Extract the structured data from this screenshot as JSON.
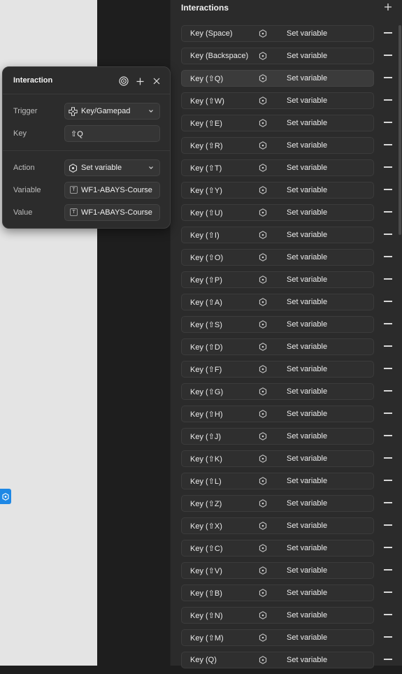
{
  "panel": {
    "title": "Interactions",
    "rows": [
      {
        "trigger": "Key (Space)",
        "action": "Set variable"
      },
      {
        "trigger": "Key (Backspace)",
        "action": "Set variable"
      },
      {
        "trigger": "Key (⇧Q)",
        "action": "Set variable",
        "selected": true
      },
      {
        "trigger": "Key (⇧W)",
        "action": "Set variable"
      },
      {
        "trigger": "Key (⇧E)",
        "action": "Set variable"
      },
      {
        "trigger": "Key (⇧R)",
        "action": "Set variable"
      },
      {
        "trigger": "Key (⇧T)",
        "action": "Set variable"
      },
      {
        "trigger": "Key (⇧Y)",
        "action": "Set variable"
      },
      {
        "trigger": "Key (⇧U)",
        "action": "Set variable"
      },
      {
        "trigger": "Key (⇧I)",
        "action": "Set variable"
      },
      {
        "trigger": "Key (⇧O)",
        "action": "Set variable"
      },
      {
        "trigger": "Key (⇧P)",
        "action": "Set variable"
      },
      {
        "trigger": "Key (⇧A)",
        "action": "Set variable"
      },
      {
        "trigger": "Key (⇧S)",
        "action": "Set variable"
      },
      {
        "trigger": "Key (⇧D)",
        "action": "Set variable"
      },
      {
        "trigger": "Key (⇧F)",
        "action": "Set variable"
      },
      {
        "trigger": "Key (⇧G)",
        "action": "Set variable"
      },
      {
        "trigger": "Key (⇧H)",
        "action": "Set variable"
      },
      {
        "trigger": "Key (⇧J)",
        "action": "Set variable"
      },
      {
        "trigger": "Key (⇧K)",
        "action": "Set variable"
      },
      {
        "trigger": "Key (⇧L)",
        "action": "Set variable"
      },
      {
        "trigger": "Key (⇧Z)",
        "action": "Set variable"
      },
      {
        "trigger": "Key (⇧X)",
        "action": "Set variable"
      },
      {
        "trigger": "Key (⇧C)",
        "action": "Set variable"
      },
      {
        "trigger": "Key (⇧V)",
        "action": "Set variable"
      },
      {
        "trigger": "Key (⇧B)",
        "action": "Set variable"
      },
      {
        "trigger": "Key (⇧N)",
        "action": "Set variable"
      },
      {
        "trigger": "Key (⇧M)",
        "action": "Set variable"
      },
      {
        "trigger": "Key (Q)",
        "action": "Set variable"
      }
    ]
  },
  "popover": {
    "title": "Interaction",
    "trigger_label": "Trigger",
    "trigger_value": "Key/Gamepad",
    "key_label": "Key",
    "key_value": "⇧Q",
    "action_label": "Action",
    "action_value": "Set variable",
    "variable_label": "Variable",
    "variable_value": "WF1-ABAYS-Course",
    "value_label": "Value",
    "value_value": "WF1-ABAYS-Course",
    "variable_type_badge": "T",
    "value_type_badge": "T"
  },
  "icons": {
    "panel_add": "plus-icon",
    "row_action": "hexagon-variable-icon",
    "row_remove": "minus-icon",
    "popover_target": "target-icon",
    "popover_add": "plus-icon",
    "popover_close": "close-icon",
    "trigger": "gamepad-icon",
    "action": "hexagon-variable-icon",
    "dropdown": "chevron-down-icon",
    "canvas_marker": "hexagon-variable-icon"
  },
  "colors": {
    "canvas": "#e4e4e4",
    "panel": "#2b2b2b",
    "accent": "#1e88e5"
  }
}
